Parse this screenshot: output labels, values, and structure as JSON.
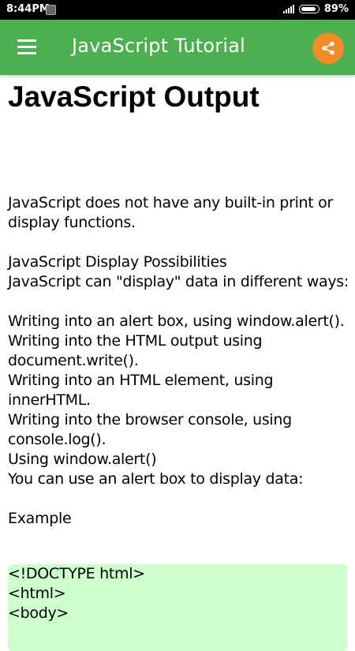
{
  "status_bar": {
    "time": "8:44PM",
    "battery_percent": "89%",
    "battery_level": 0.89
  },
  "app_bar": {
    "title": "JavaScript Tutorial",
    "color": "#4caf50",
    "share_color": "#f28c28"
  },
  "page": {
    "title": "JavaScript Output",
    "paragraphs": [
      "JavaScript does not have any built-in print or display functions.",
      "",
      "JavaScript Display Possibilities",
      "JavaScript can \"display\" data in different ways:",
      "",
      "Writing into an alert box, using window.alert().",
      "Writing into the HTML output using document.write().",
      "Writing into an HTML element, using innerHTML.",
      "Writing into the browser console, using console.log().",
      "Using window.alert()",
      "You can use an alert box to display data:",
      "",
      "Example"
    ],
    "code_lines": [
      "<!DOCTYPE html>",
      "<html>",
      "<body>"
    ],
    "code_bg": "#ccffcc"
  }
}
